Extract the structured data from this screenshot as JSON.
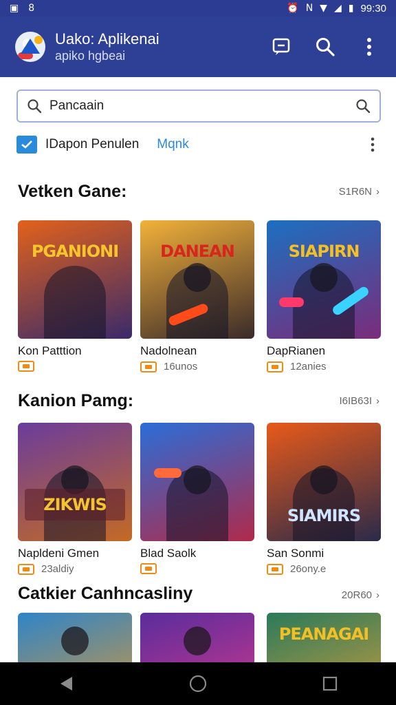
{
  "status_bar": {
    "time": "99:30",
    "left_icons": [
      "gallery-icon",
      "sync-icon"
    ],
    "right_icons": [
      "alarm-icon",
      "nfc-icon",
      "wifi-icon",
      "signal-icon",
      "battery-icon"
    ]
  },
  "app_bar": {
    "title": "Uako: Aplikenai",
    "subtitle": "apiko hgbeai",
    "actions": [
      "message-icon",
      "search-icon",
      "more-vert-icon"
    ]
  },
  "search": {
    "value": "Pancaain",
    "placeholder": "Pancaain"
  },
  "filter": {
    "label": "IDapon Penulen",
    "link": "Mqnk"
  },
  "sections": [
    {
      "title": "Vetken Gane:",
      "more": "S1R6N",
      "cards": [
        {
          "name": "Kon Patttion",
          "meta": "",
          "banner": "PGANIONI",
          "colors": [
            "#e2611c",
            "#3a2a6a"
          ]
        },
        {
          "name": "Nadolnean",
          "meta": "16unos",
          "banner": "DANEAN",
          "colors": [
            "#f2b13a",
            "#3a2a2a"
          ]
        },
        {
          "name": "DapRianen",
          "meta": "12anies",
          "banner": "SIAPIRN",
          "colors": [
            "#1d6fc0",
            "#7a2c7a"
          ]
        }
      ]
    },
    {
      "title": "Kanion Pamg:",
      "more": "I6IB63I",
      "cards": [
        {
          "name": "Napldeni Gmen",
          "meta": "23aldiy",
          "banner": "ZIKWIS",
          "colors": [
            "#6a3c9c",
            "#c46a24"
          ]
        },
        {
          "name": "Blad Saolk",
          "meta": "",
          "banner": "",
          "colors": [
            "#2b6dd8",
            "#b02a4a"
          ]
        },
        {
          "name": "San Sonmi",
          "meta": "26ony.e",
          "banner": "SIAMIRS",
          "colors": [
            "#e85a1a",
            "#2a2a4a"
          ]
        }
      ]
    },
    {
      "title": "Catkier Canhncasliny",
      "more": "20R60",
      "cards": [
        {
          "name": "",
          "meta": "",
          "banner": "",
          "colors": [
            "#2f84c8",
            "#e59a2a"
          ]
        },
        {
          "name": "",
          "meta": "",
          "banner": "",
          "colors": [
            "#5a2c9c",
            "#e03a8a"
          ]
        },
        {
          "name": "",
          "meta": "",
          "banner": "PEANAGAI",
          "colors": [
            "#2b7a5a",
            "#e0a23a"
          ]
        }
      ]
    }
  ],
  "nav_bar": {
    "buttons": [
      "back-icon",
      "home-icon",
      "recents-icon"
    ]
  }
}
